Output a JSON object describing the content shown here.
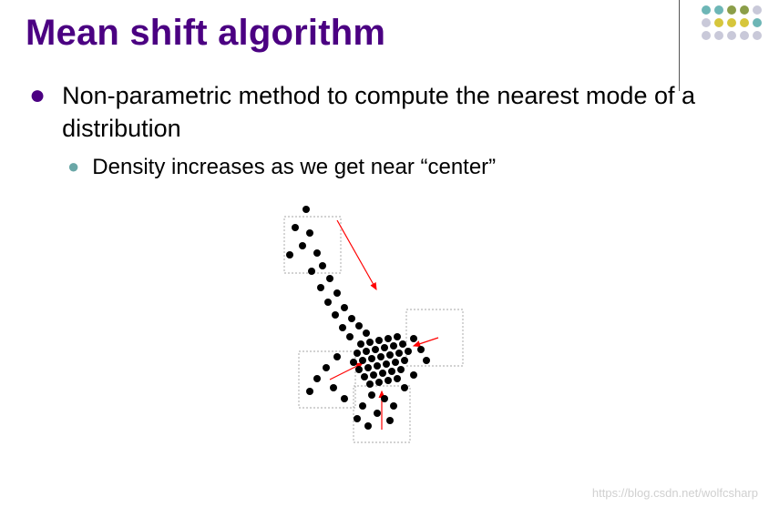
{
  "title": "Mean shift algorithm",
  "bullets": {
    "l1": "Non-parametric method to compute the nearest mode of a distribution",
    "l2": "Density increases as we get near “center”"
  },
  "watermark": "https://blog.csdn.net/wolfcsharp",
  "decor": {
    "rows": [
      [
        "#6db6b6",
        "#6db6b6",
        "#8b9e49",
        "#8b9e49",
        "#c9c9d9"
      ],
      [
        "#c9c9d9",
        "#d6c63c",
        "#d6c63c",
        "#d6c63c",
        "#6db6b6"
      ],
      [
        "#c9c9d9",
        "#c9c9d9",
        "#c9c9d9",
        "#c9c9d9",
        "#c9c9d9"
      ]
    ]
  }
}
